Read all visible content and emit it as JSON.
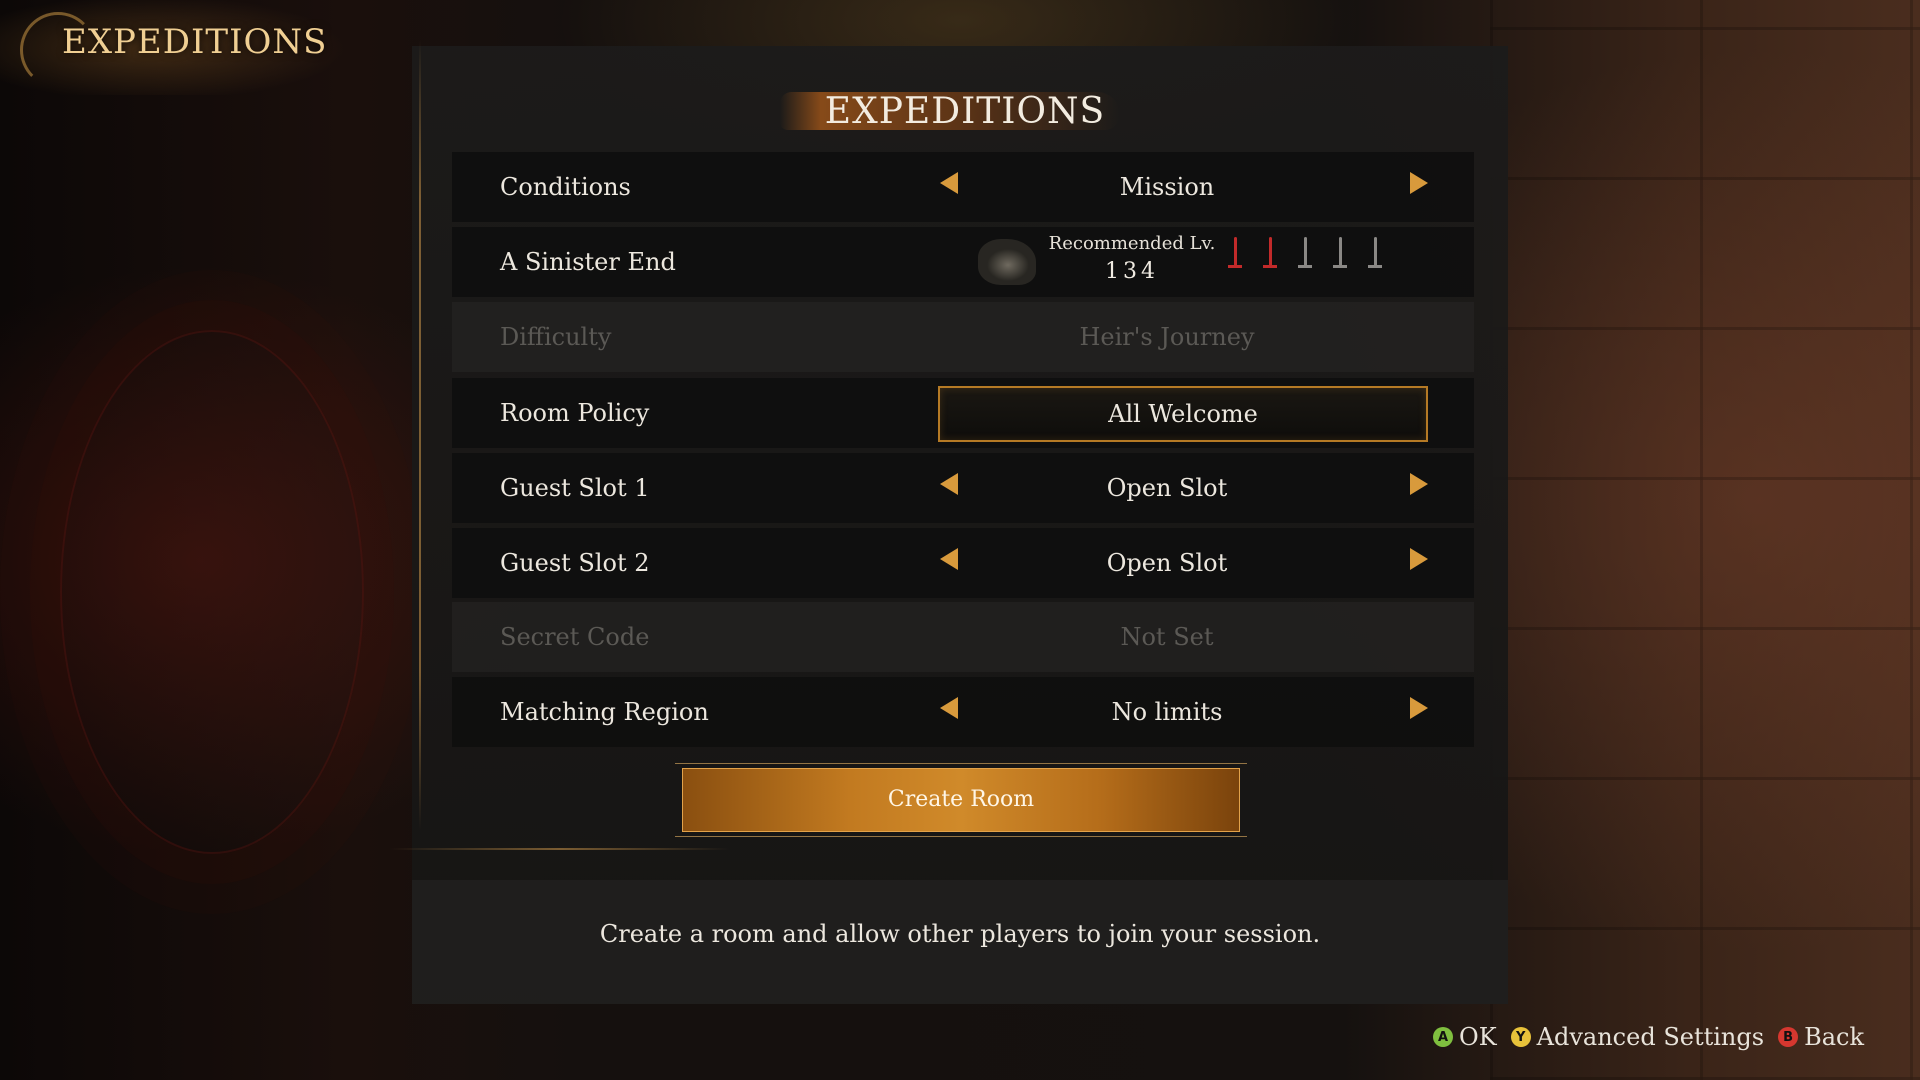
{
  "screen_title": "EXPEDITIONS",
  "panel_title": "EXPEDITIONS",
  "rows": {
    "conditions": {
      "label": "Conditions",
      "value": "Mission"
    },
    "mission": {
      "label": "A Sinister End",
      "recommended_label": "Recommended Lv.",
      "recommended_level": "134",
      "difficulty_swords_filled": 2,
      "difficulty_swords_total": 5
    },
    "difficulty": {
      "label": "Difficulty",
      "value": "Heir's Journey"
    },
    "room_policy": {
      "label": "Room Policy",
      "value": "All Welcome"
    },
    "guest_slot_1": {
      "label": "Guest Slot 1",
      "value": "Open Slot"
    },
    "guest_slot_2": {
      "label": "Guest Slot 2",
      "value": "Open Slot"
    },
    "secret_code": {
      "label": "Secret Code",
      "value": "Not Set"
    },
    "matching_region": {
      "label": "Matching Region",
      "value": "No limits"
    }
  },
  "create_button": "Create Room",
  "description": "Create a room and allow other players to join your session.",
  "hints": {
    "ok": {
      "glyph": "A",
      "label": "OK",
      "color": "#7fbf3f"
    },
    "advanced": {
      "glyph": "Y",
      "label": "Advanced Settings",
      "color": "#e8c23a"
    },
    "back": {
      "glyph": "B",
      "label": "Back",
      "color": "#d6372f"
    }
  },
  "colors": {
    "accent": "#d89a3c",
    "button": "#c27a20"
  }
}
